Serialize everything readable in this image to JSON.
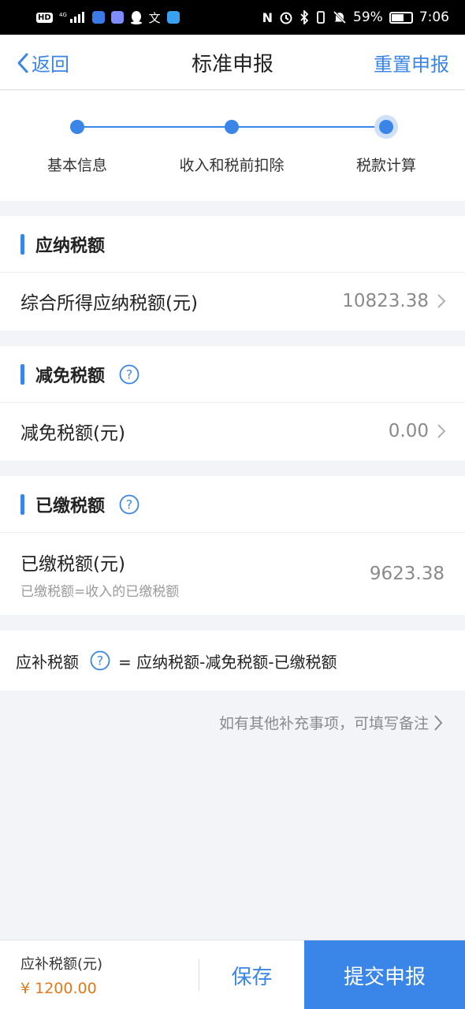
{
  "status_bar": {
    "left_tag": "HD",
    "network": "4G",
    "battery": "59%",
    "time": "7:06",
    "icons": [
      "signal-icon",
      "lightbulb-icon",
      "music-icon",
      "qq-icon",
      "translate-icon",
      "send-icon",
      "nfc-icon",
      "alarm-icon",
      "bluetooth-icon",
      "vibrate-icon",
      "mute-icon",
      "battery-icon"
    ]
  },
  "nav": {
    "back_label": "返回",
    "title": "标准申报",
    "reset_label": "重置申报"
  },
  "steps": [
    {
      "label": "基本信息",
      "state": "done"
    },
    {
      "label": "收入和税前扣除",
      "state": "done"
    },
    {
      "label": "税款计算",
      "state": "active"
    }
  ],
  "sections": {
    "payable": {
      "title": "应纳税额",
      "row_label": "综合所得应纳税额(元)",
      "row_value": "10823.38"
    },
    "relief": {
      "title": "减免税额",
      "row_label": "减免税额(元)",
      "row_value": "0.00"
    },
    "paid": {
      "title": "已缴税额",
      "row_label": "已缴税额(元)",
      "row_sub": "已缴税额=收入的已缴税额",
      "row_value": "9623.38"
    }
  },
  "formula": {
    "label": "应补税额",
    "expression": "= 应纳税额-减免税额-已缴税额"
  },
  "remark": "如有其他补充事项，可填写备注",
  "bottom": {
    "label": "应补税额(元)",
    "amount": "¥ 1200.00",
    "save_label": "保存",
    "submit_label": "提交申报"
  },
  "colors": {
    "accent": "#3a86e8",
    "amount": "#e07a1a"
  }
}
